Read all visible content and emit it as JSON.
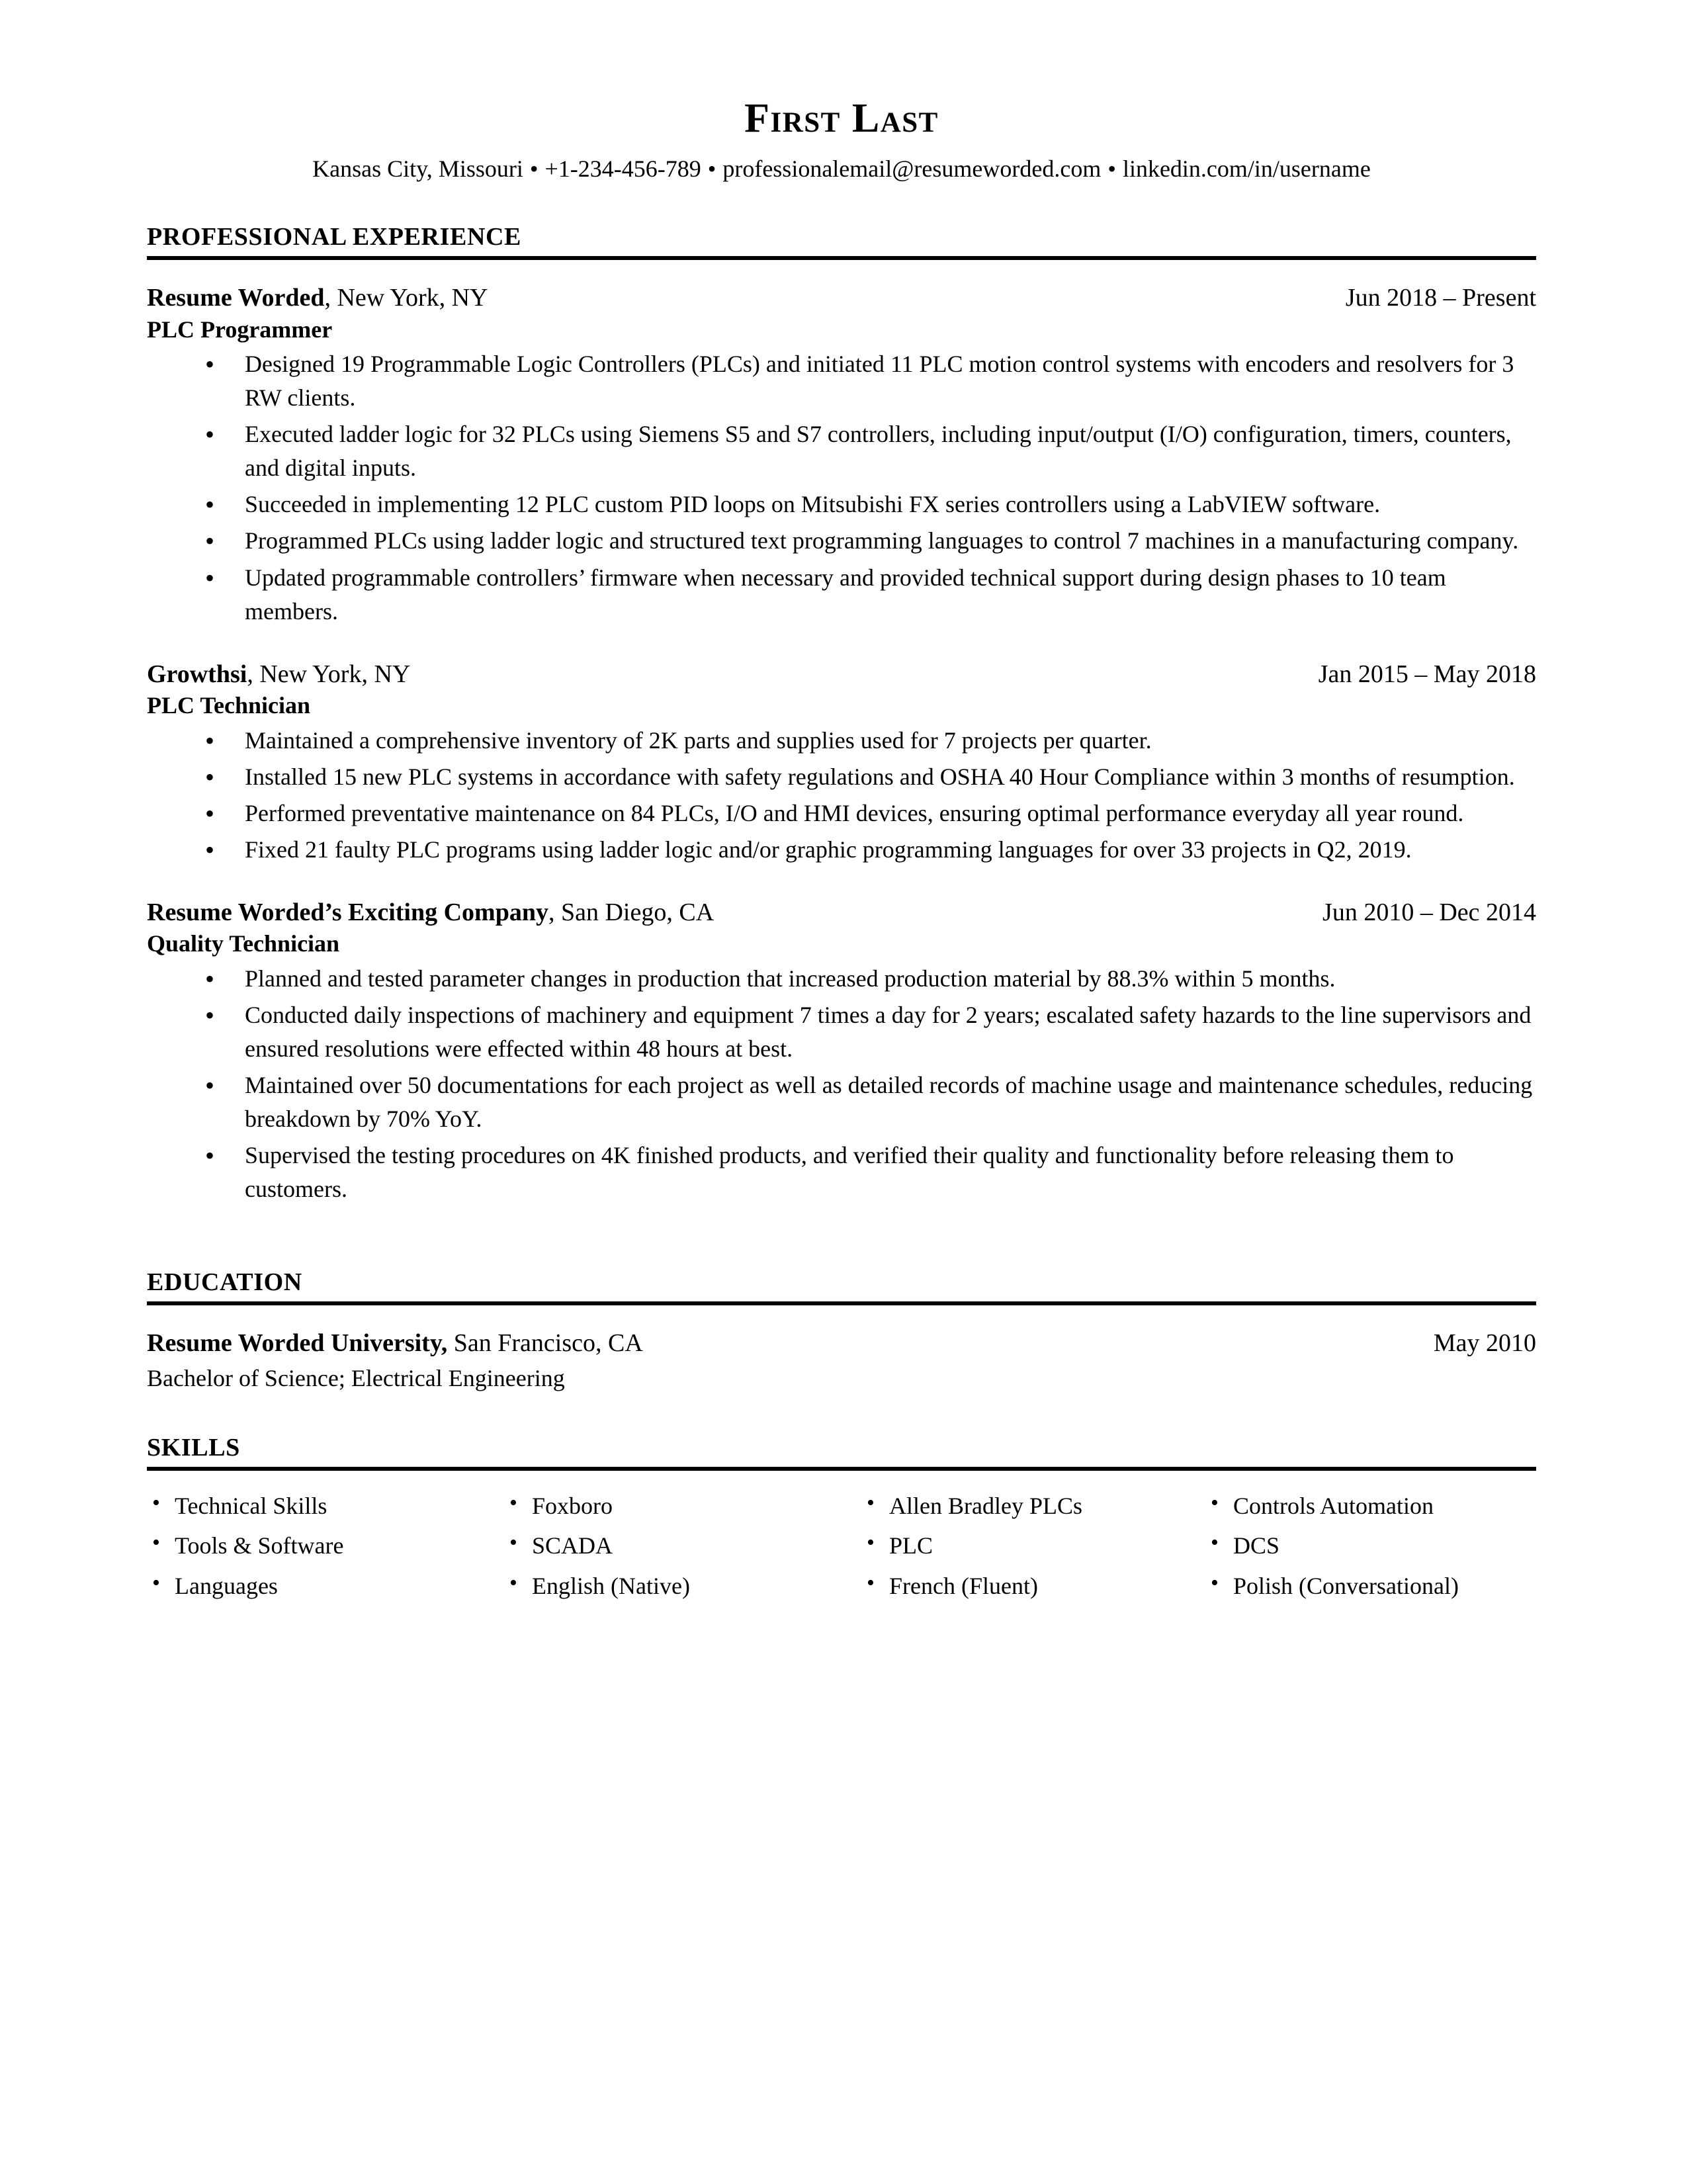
{
  "header": {
    "name": "First Last",
    "location": "Kansas City, Missouri",
    "phone": "+1-234-456-789",
    "email": "professionalemail@resumeworded.com",
    "linkedin": "linkedin.com/in/username",
    "separator": "•"
  },
  "sections": {
    "experience_title": "PROFESSIONAL EXPERIENCE",
    "education_title": "EDUCATION",
    "skills_title": "SKILLS"
  },
  "experience": [
    {
      "company": "Resume Worded",
      "location": ", New York, NY",
      "dates": "Jun 2018 – Present",
      "title": "PLC Programmer",
      "bullets": [
        "Designed 19 Programmable Logic Controllers (PLCs) and initiated 11 PLC motion control systems with encoders and resolvers for 3 RW clients.",
        "Executed ladder logic for 32 PLCs using Siemens S5 and S7 controllers, including input/output (I/O) configuration, timers, counters, and digital inputs.",
        "Succeeded in implementing 12 PLC custom PID loops on Mitsubishi FX series controllers using a LabVIEW software.",
        "Programmed PLCs using ladder logic and structured text programming languages to control 7 machines in a manufacturing company.",
        "Updated programmable controllers’ firmware when necessary and provided technical support during design phases to 10 team members."
      ]
    },
    {
      "company": "Growthsi",
      "location": ", New York, NY",
      "dates": "Jan 2015 – May 2018",
      "title": "PLC Technician",
      "bullets": [
        "Maintained a comprehensive inventory of 2K parts and supplies used for 7 projects per quarter.",
        "Installed 15 new PLC systems in accordance with safety regulations and OSHA 40 Hour Compliance within 3 months of resumption.",
        "Performed preventative maintenance on 84 PLCs, I/O and HMI devices, ensuring optimal performance everyday all year round.",
        "Fixed 21 faulty PLC programs using ladder logic and/or graphic programming languages for over 33 projects in Q2, 2019."
      ]
    },
    {
      "company": "Resume Worded’s Exciting Company",
      "location": ", San Diego, CA",
      "dates": "Jun 2010 – Dec 2014",
      "title": "Quality Technician",
      "bullets": [
        "Planned and tested parameter changes in production that increased production material by 88.3% within 5 months.",
        "Conducted daily inspections of machinery and equipment 7 times a day for 2 years; escalated safety hazards to the line supervisors and ensured resolutions were effected within 48 hours at best.",
        "Maintained over 50 documentations for each project as well as detailed records of machine usage and maintenance schedules, reducing breakdown by 70% YoY.",
        "Supervised the testing procedures on 4K finished products, and verified their quality and functionality before releasing them to customers."
      ]
    }
  ],
  "education": [
    {
      "school": "Resume Worded University,",
      "location": " San Francisco, CA",
      "date": "May 2010",
      "degree": "Bachelor of Science; Electrical Engineering"
    }
  ],
  "skills": [
    [
      "Technical Skills",
      "Foxboro",
      "Allen Bradley PLCs",
      "Controls Automation"
    ],
    [
      "Tools & Software",
      "SCADA",
      "PLC",
      "DCS"
    ],
    [
      "Languages",
      "English (Native)",
      "French (Fluent)",
      "Polish (Conversational)"
    ]
  ]
}
